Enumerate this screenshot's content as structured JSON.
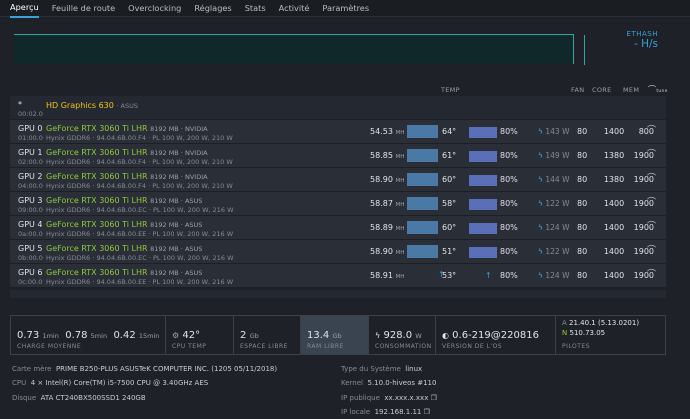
{
  "nav": {
    "tabs": [
      "Aperçu",
      "Feuille de route",
      "Overclocking",
      "Réglages",
      "Stats",
      "Activité",
      "Paramètres"
    ]
  },
  "algo": {
    "name": "ETHASH",
    "rate": "- H/s"
  },
  "columns": {
    "temp": "TEMP",
    "fan": "FAN",
    "core": "CORE",
    "mem": "MEM",
    "tune": "tune"
  },
  "igpu": {
    "id": "*",
    "bus": "00:02.0",
    "name": "HD Graphics 630",
    "vendor": "· ASUS"
  },
  "gpus": [
    {
      "id": "GPU 0",
      "bus": "01:00.0",
      "name": "GeForce RTX 3060 Ti LHR",
      "mem": "8192 MB · NVIDIA",
      "info": "Hynix GDDR6 · 94.04.6B.00.F4 · PL 100 W, 200 W, 210 W",
      "hash": "54.53",
      "temp": "64°",
      "fan": "80%",
      "pw": "143",
      "core": "1400",
      "memc": "800"
    },
    {
      "id": "GPU 1",
      "bus": "02:00.0",
      "name": "GeForce RTX 3060 Ti LHR",
      "mem": "8192 MB · NVIDIA",
      "info": "Hynix GDDR6 · 94.04.6B.00.F4 · PL 100 W, 200 W, 210 W",
      "hash": "58.85",
      "temp": "61°",
      "fan": "80%",
      "pw": "149",
      "core": "1380",
      "memc": "1900"
    },
    {
      "id": "GPU 2",
      "bus": "04:00.0",
      "name": "GeForce RTX 3060 Ti LHR",
      "mem": "8192 MB · NVIDIA",
      "info": "Hynix GDDR6 · 94.04.6B.00.F4 · PL 100 W, 200 W, 210 W",
      "hash": "58.90",
      "temp": "60°",
      "fan": "80%",
      "pw": "144",
      "core": "1380",
      "memc": "1900"
    },
    {
      "id": "GPU 3",
      "bus": "09:00.0",
      "name": "GeForce RTX 3060 Ti LHR",
      "mem": "8192 MB · ASUS",
      "info": "Hynix GDDR6 · 94.04.6B.00.EC · PL 100 W, 200 W, 216 W",
      "hash": "58.87",
      "temp": "58°",
      "fan": "80%",
      "pw": "122",
      "core": "1400",
      "memc": "1900"
    },
    {
      "id": "GPU 4",
      "bus": "0a:00.0",
      "name": "GeForce RTX 3060 Ti LHR",
      "mem": "8192 MB · ASUS",
      "info": "Hynix GDDR6 · 94.04.6B.00.EE · PL 100 W, 200 W, 216 W",
      "hash": "58.89",
      "temp": "60°",
      "fan": "80%",
      "pw": "124",
      "core": "1400",
      "memc": "1900"
    },
    {
      "id": "GPU 5",
      "bus": "0b:00.0",
      "name": "GeForce RTX 3060 Ti LHR",
      "mem": "8192 MB · ASUS",
      "info": "Hynix GDDR6 · 94.04.6B.00.EC · PL 100 W, 200 W, 216 W",
      "hash": "58.90",
      "temp": "51°",
      "fan": "80%",
      "pw": "122",
      "core": "1400",
      "memc": "1900"
    },
    {
      "id": "GPU 6",
      "bus": "0c:00.0",
      "name": "GeForce RTX 3060 Ti LHR",
      "mem": "8192 MB · ASUS",
      "info": "Hynix GDDR6 · 94.04.6B.00.EE · PL 100 W, 200 W, 216 W",
      "hash": "58.91",
      "temp": "53°",
      "fan": "80%",
      "pw": "124",
      "core": "1400",
      "memc": "1900"
    }
  ],
  "units": {
    "hash": "MH",
    "pw": "W"
  },
  "stats": {
    "load1": "0.73",
    "load1u": "1min",
    "load5": "0.78",
    "load5u": "5min",
    "load15": "0.42",
    "load15u": "15min",
    "loadlbl": "CHARGE MOYENNE",
    "cpu": "42°",
    "cpulbl": "CPU TEMP",
    "disk": "2",
    "diskunit": "Gb",
    "disklbl": "ESPACE LIBRE",
    "ram": "13.4",
    "ramunit": "Gb",
    "ramlbl": "RAM LIBRE",
    "cons": "928.0",
    "consunit": "W",
    "conslbl": "CONSOMMATION",
    "os": "0.6-219@220816",
    "oslbl": "VERSION DE L'OS",
    "drvA": "21.40.1 (5.13.0201)",
    "drvN": "510.73.05",
    "drvlbl": "PILOTES"
  },
  "info": {
    "mb_label": "Carte mère",
    "mb": "PRIME B250-PLUS ASUSTeK COMPUTER INC. (1205 05/11/2018)",
    "cpu_label": "CPU",
    "cpu": "4 × Intel(R) Core(TM) i5-7500 CPU @ 3.40GHz",
    "aes": "AES",
    "disk_label": "Disque",
    "disk": "ATA CT240BX500SSD1 240GB",
    "os_label": "Type du Système",
    "os": "linux",
    "kernel_label": "Kernel",
    "kernel": "5.10.0-hiveos #110",
    "pubip_label": "IP publique",
    "pubip": "xx.xxx.x.xxx",
    "lanip_label": "IP locale",
    "lanip": "192.168.1.11"
  }
}
